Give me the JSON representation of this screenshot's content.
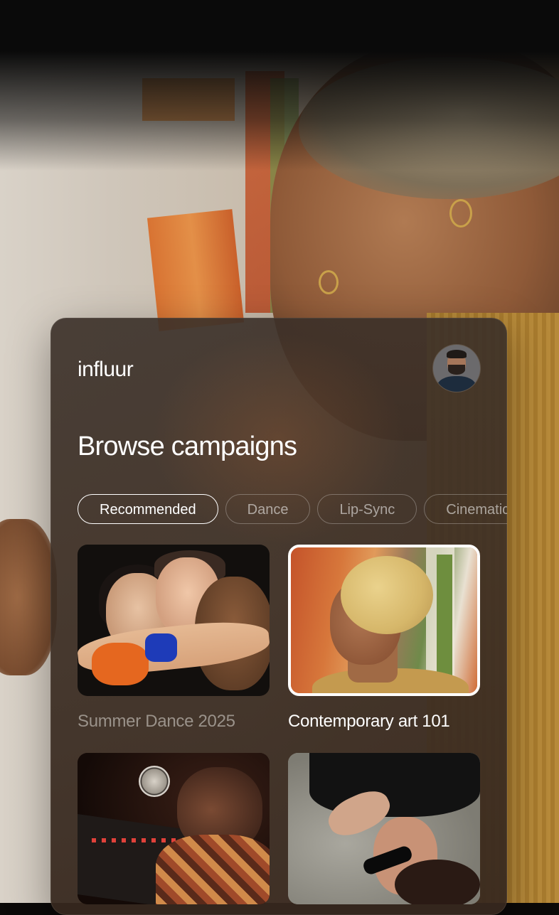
{
  "app": {
    "logo": "influur"
  },
  "page": {
    "title": "Browse campaigns"
  },
  "filters": [
    {
      "label": "Recommended",
      "active": true
    },
    {
      "label": "Dance",
      "active": false
    },
    {
      "label": "Lip-Sync",
      "active": false
    },
    {
      "label": "Cinematic",
      "active": false
    }
  ],
  "campaigns": [
    {
      "title": "Summer Dance 2025",
      "selected": false
    },
    {
      "title": "Contemporary art 101",
      "selected": true
    },
    {
      "title": "",
      "selected": false
    },
    {
      "title": "",
      "selected": false
    }
  ],
  "colors": {
    "text_primary": "#ffffff",
    "text_muted": "#9a928a",
    "card_bg": "#3a2f28"
  }
}
